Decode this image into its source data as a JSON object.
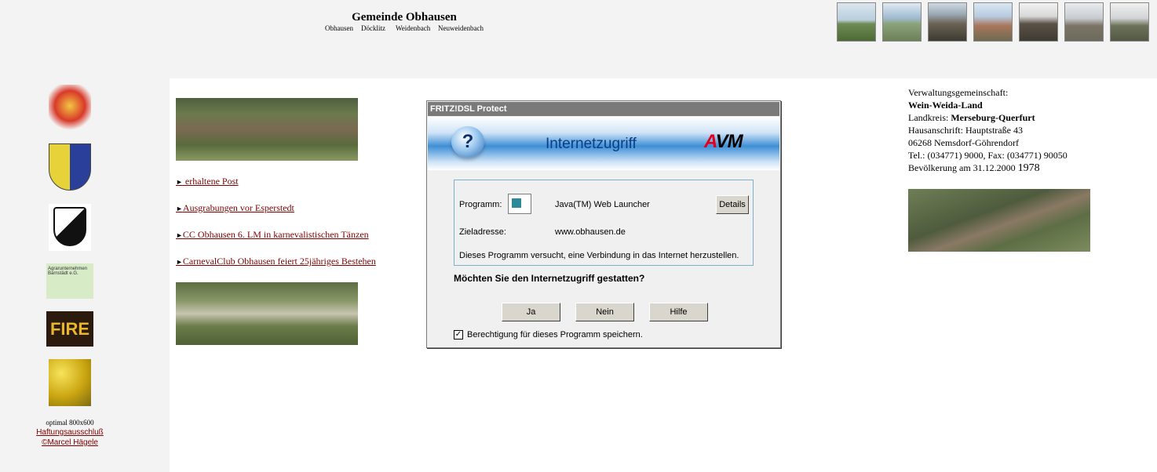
{
  "header": {
    "title": "Gemeinde Obhausen",
    "villages": [
      "Obhausen",
      "Döcklitz",
      "Weidenbach",
      "Neuweidenbach"
    ]
  },
  "sidebar": {
    "logos": [
      "carnival-club-logo",
      "coat-of-arms",
      "sv-football-logo",
      "agrarunternehmen-logo",
      "fire-logo",
      "rapeseed-field-image"
    ],
    "agrar_text": "Agrarunternehmen Barnstädt e.G.",
    "fire_text": "FIRE",
    "optimal": "optimal 800x600",
    "disclaimer": "Haftungsausschluß",
    "copyright": "©Marcel Hägele"
  },
  "links": [
    " erhaltene Post",
    "Ausgrabungen vor Esperstedt",
    "CC Obhausen  6. LM in karnevalistischen Tänzen ",
    "CarnevalClub Obhausen feiert 25jähriges Bestehen"
  ],
  "info": {
    "line1": "Verwaltungsgemeinschaft:",
    "vg_name": "Wein-Weida-Land",
    "landkreis_label": "Landkreis: ",
    "landkreis": "Merseburg-Querfurt",
    "address": "Hausanschrift: Hauptstraße 43",
    "city": "06268 Nemsdorf-Göhrendorf",
    "tel": "Tel.: (034771) 9000, Fax: (034771) 90050",
    "population_label": "Bevölkerung am 31.12.2000 ",
    "population": "1978"
  },
  "dialog": {
    "window_title": "FRITZ!DSL Protect",
    "banner_title": "Internetzugriff",
    "brand": "AVM",
    "program_label": "Programm:",
    "program_value": "Java(TM) Web Launcher",
    "details_button": "Details",
    "target_label": "Zieladresse:",
    "target_value": "www.obhausen.de",
    "message": "Dieses Programm versucht, eine Verbindung in das Internet herzustellen.",
    "question": "Möchten Sie den Internetzugriff gestatten?",
    "yes_button": "Ja",
    "no_button": "Nein",
    "help_button": "Hilfe",
    "remember_label": "Berechtigung für dieses Programm speichern.",
    "remember_checked": true
  },
  "colors": {
    "link": "#800000",
    "panel_bg": "#f3f3f3",
    "dialog_title_bar": "#7a7a7a",
    "dialog_brand_red": "#e2001a"
  }
}
